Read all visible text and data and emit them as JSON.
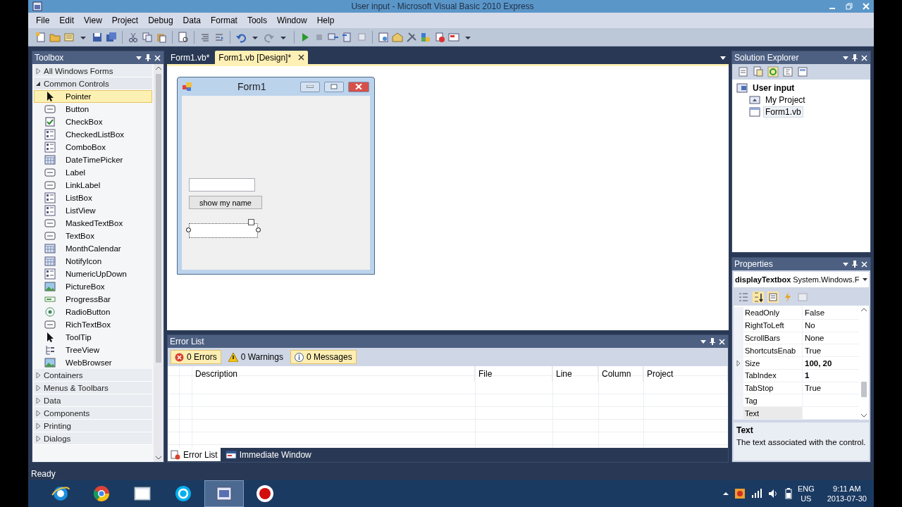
{
  "window": {
    "title": "User input - Microsoft Visual Basic 2010 Express"
  },
  "menu": [
    "File",
    "Edit",
    "View",
    "Project",
    "Debug",
    "Data",
    "Format",
    "Tools",
    "Window",
    "Help"
  ],
  "toolbox": {
    "title": "Toolbox",
    "groups": [
      {
        "label": "All Windows Forms",
        "expanded": false
      },
      {
        "label": "Common Controls",
        "expanded": true,
        "items": [
          {
            "label": "Pointer",
            "selected": true
          },
          {
            "label": "Button",
            "selected": false
          },
          {
            "label": "CheckBox",
            "selected": false
          },
          {
            "label": "CheckedListBox",
            "selected": false
          },
          {
            "label": "ComboBox",
            "selected": false
          },
          {
            "label": "DateTimePicker",
            "selected": false
          },
          {
            "label": "Label",
            "selected": false
          },
          {
            "label": "LinkLabel",
            "selected": false
          },
          {
            "label": "ListBox",
            "selected": false
          },
          {
            "label": "ListView",
            "selected": false
          },
          {
            "label": "MaskedTextBox",
            "selected": false
          },
          {
            "label": "TextBox",
            "selected": false
          },
          {
            "label": "MonthCalendar",
            "selected": false
          },
          {
            "label": "NotifyIcon",
            "selected": false
          },
          {
            "label": "NumericUpDown",
            "selected": false
          },
          {
            "label": "PictureBox",
            "selected": false
          },
          {
            "label": "ProgressBar",
            "selected": false
          },
          {
            "label": "RadioButton",
            "selected": false
          },
          {
            "label": "RichTextBox",
            "selected": false
          },
          {
            "label": "ToolTip",
            "selected": false
          },
          {
            "label": "TreeView",
            "selected": false
          },
          {
            "label": "WebBrowser",
            "selected": false
          }
        ]
      },
      {
        "label": "Containers",
        "expanded": false
      },
      {
        "label": "Menus & Toolbars",
        "expanded": false
      },
      {
        "label": "Data",
        "expanded": false
      },
      {
        "label": "Components",
        "expanded": false
      },
      {
        "label": "Printing",
        "expanded": false
      },
      {
        "label": "Dialogs",
        "expanded": false
      }
    ]
  },
  "document_tabs": [
    {
      "label": "Form1.vb*",
      "selected": false
    },
    {
      "label": "Form1.vb [Design]*",
      "selected": true
    }
  ],
  "form": {
    "title": "Form1",
    "button": "show my name",
    "textboxes": [
      {
        "selected": false
      },
      {
        "selected": true
      }
    ]
  },
  "error_list": {
    "title": "Error List",
    "filters": [
      {
        "label": "0 Errors",
        "selected": true
      },
      {
        "label": "0 Warnings",
        "selected": false
      },
      {
        "label": "0 Messages",
        "selected": true
      }
    ],
    "columns": [
      "Description",
      "File",
      "Line",
      "Column",
      "Project"
    ],
    "tabs": [
      {
        "label": "Error List",
        "selected": true
      },
      {
        "label": "Immediate Window",
        "selected": false
      }
    ]
  },
  "solution_explorer": {
    "title": "Solution Explorer",
    "tree": [
      {
        "label": "User input",
        "selected": false,
        "children": [
          {
            "label": "My Project",
            "selected": false
          },
          {
            "label": "Form1.vb",
            "selected": true
          }
        ]
      }
    ]
  },
  "properties": {
    "title": "Properties",
    "object": "displayTextbox",
    "type": "System.Windows.F",
    "rows": [
      {
        "name": "ReadOnly",
        "value": "False",
        "modified": false,
        "expandable": false,
        "selected": false
      },
      {
        "name": "RightToLeft",
        "value": "No",
        "modified": false,
        "expandable": false,
        "selected": false
      },
      {
        "name": "ScrollBars",
        "value": "None",
        "modified": false,
        "expandable": false,
        "selected": false
      },
      {
        "name": "ShortcutsEnab",
        "value": "True",
        "modified": false,
        "expandable": false,
        "selected": false
      },
      {
        "name": "Size",
        "value": "100, 20",
        "modified": true,
        "expandable": true,
        "selected": false
      },
      {
        "name": "TabIndex",
        "value": "1",
        "modified": true,
        "expandable": false,
        "selected": false
      },
      {
        "name": "TabStop",
        "value": "True",
        "modified": false,
        "expandable": false,
        "selected": false
      },
      {
        "name": "Tag",
        "value": "",
        "expandable": false,
        "selected": false
      },
      {
        "name": "Text",
        "value": "",
        "expandable": false,
        "selected": true
      }
    ],
    "description": {
      "title": "Text",
      "text": "The text associated with the control."
    }
  },
  "status_bar": "Ready",
  "taskbar": {
    "apps": [
      {
        "selected": false
      },
      {
        "selected": false
      },
      {
        "selected": false
      },
      {
        "selected": false
      },
      {
        "selected": true
      },
      {
        "selected": false
      }
    ],
    "language": "ENG",
    "region": "US",
    "time": "9:11 AM",
    "date": "2013-07-30"
  }
}
